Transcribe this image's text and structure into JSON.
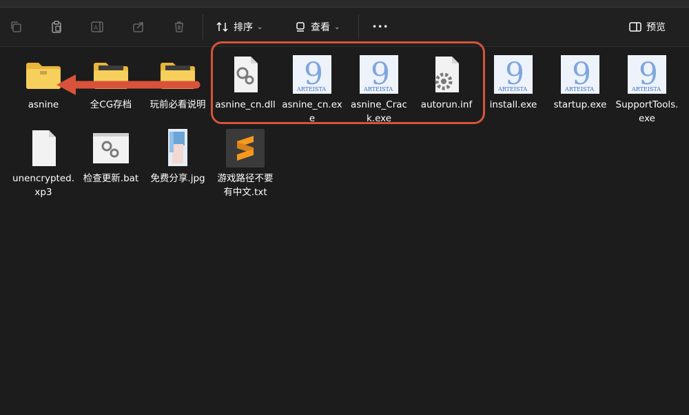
{
  "toolbar": {
    "sort_label": "排序",
    "view_label": "查看",
    "more_label": "•••",
    "preview_label": "预览"
  },
  "files": [
    {
      "label": "asnine",
      "icon": "folder-icon"
    },
    {
      "label": "全CG存档",
      "icon": "folder-icon"
    },
    {
      "label": "玩前必看说明",
      "icon": "folder-icon"
    },
    {
      "label": "asnine_cn.dll",
      "icon": "dll-file-icon"
    },
    {
      "label": "asnine_cn.exe",
      "icon": "artemis-exe-icon"
    },
    {
      "label": "asnine_Crack.exe",
      "icon": "artemis-exe-icon"
    },
    {
      "label": "autorun.inf",
      "icon": "settings-file-icon"
    },
    {
      "label": "install.exe",
      "icon": "artemis-exe-icon"
    },
    {
      "label": "startup.exe",
      "icon": "artemis-exe-icon"
    },
    {
      "label": "SupportTools.exe",
      "icon": "artemis-exe-icon"
    },
    {
      "label": "unencrypted.xp3",
      "icon": "blank-file-icon"
    },
    {
      "label": "检查更新.bat",
      "icon": "batch-file-icon"
    },
    {
      "label": "免费分享.jpg",
      "icon": "image-file-icon"
    },
    {
      "label": "游戏路径不要有中文.txt",
      "icon": "sublime-text-icon"
    }
  ],
  "annotation": {
    "highlight_color": "#d9533a"
  }
}
